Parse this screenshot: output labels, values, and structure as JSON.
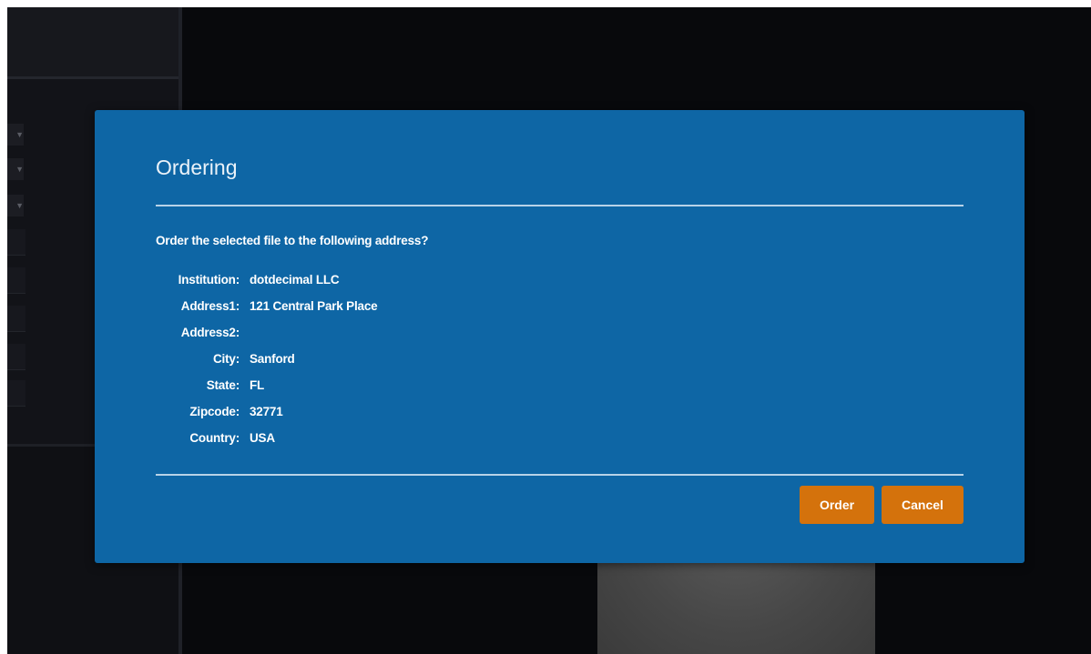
{
  "dialog": {
    "title": "Ordering",
    "question": "Order the selected file to the following address?",
    "fields": [
      {
        "label": "Institution:",
        "value": "dotdecimal LLC"
      },
      {
        "label": "Address1:",
        "value": "121 Central Park Place"
      },
      {
        "label": "Address2:",
        "value": ""
      },
      {
        "label": "City:",
        "value": "Sanford"
      },
      {
        "label": "State:",
        "value": "FL"
      },
      {
        "label": "Zipcode:",
        "value": "32771"
      },
      {
        "label": "Country:",
        "value": "USA"
      }
    ],
    "order_label": "Order",
    "cancel_label": "Cancel"
  },
  "background": {
    "dropdown_arrow": "▼"
  },
  "colors": {
    "dialog_bg": "#0e66a5",
    "button_bg": "#d4720c",
    "app_bg": "#0b0c10"
  }
}
